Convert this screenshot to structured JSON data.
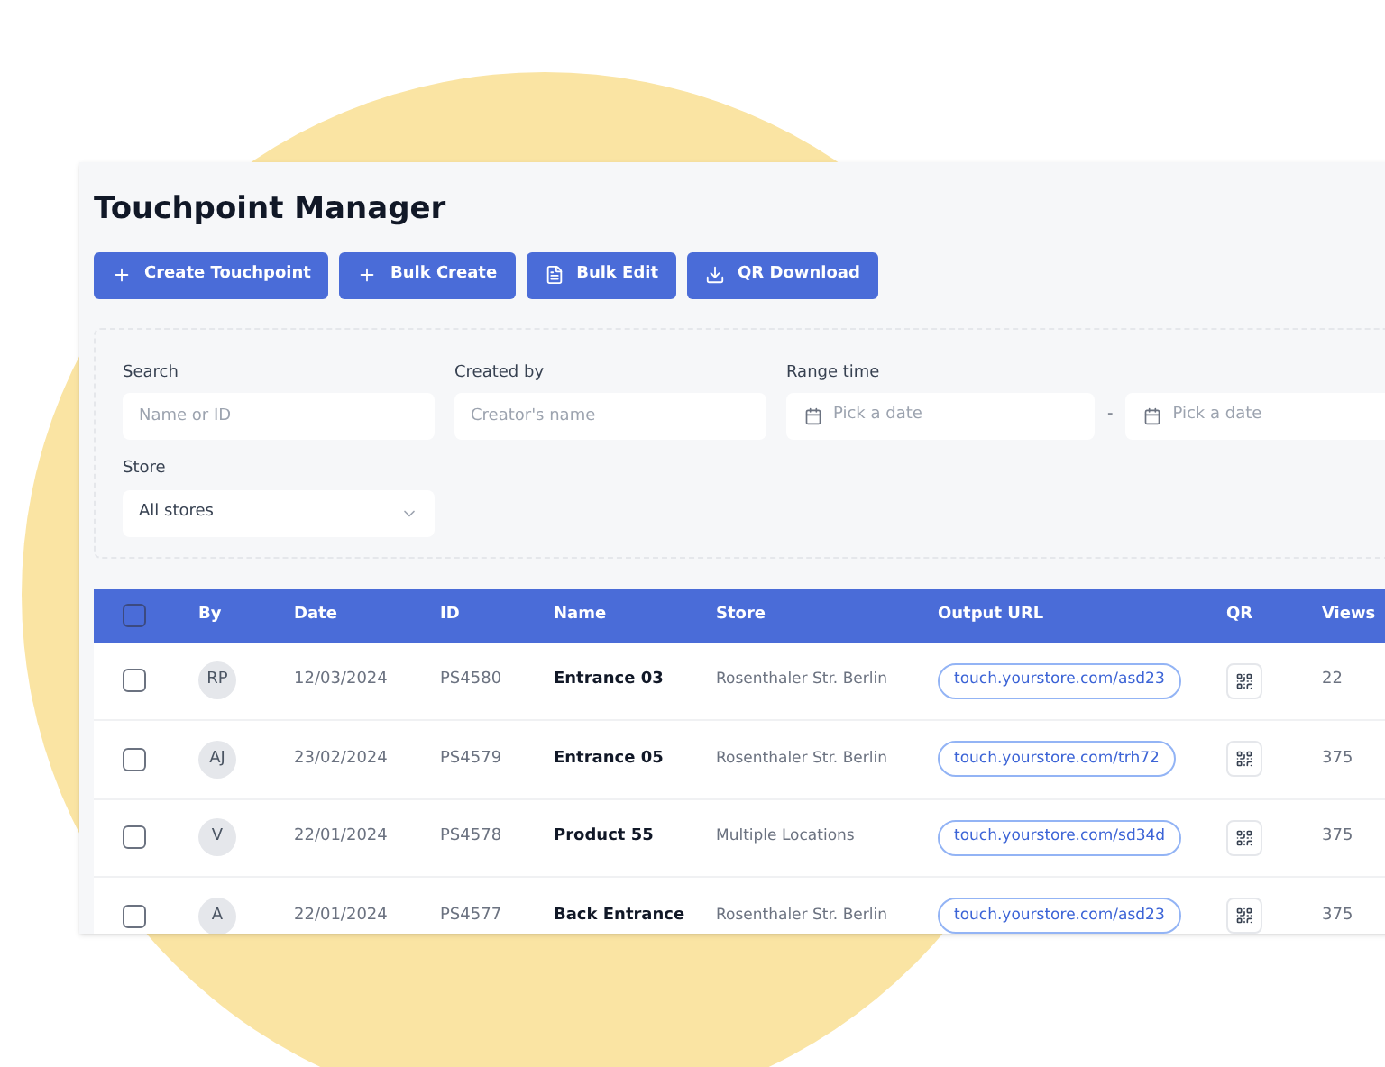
{
  "title": "Touchpoint Manager",
  "actions": [
    {
      "label": "Create Touchpoint",
      "kind": "plus"
    },
    {
      "label": "Bulk Create",
      "kind": "plus"
    },
    {
      "label": "Bulk Edit",
      "kind": "file"
    },
    {
      "label": "QR Download",
      "kind": "download"
    }
  ],
  "filters": {
    "search": {
      "label": "Search",
      "placeholder": "Name or ID"
    },
    "created_by": {
      "label": "Created by",
      "placeholder": "Creator's name"
    },
    "range_time": {
      "label": "Range time",
      "from_placeholder": "Pick a date",
      "separator": "-",
      "to_placeholder": "Pick a date"
    },
    "store": {
      "label": "Store",
      "value": "All stores"
    }
  },
  "table": {
    "select_all_checked": false,
    "columns": [
      "By",
      "Date",
      "ID",
      "Name",
      "Store",
      "Output URL",
      "QR",
      "Views"
    ],
    "rows": [
      {
        "checked": false,
        "by": "RP",
        "date": "12/03/2024",
        "id": "PS4580",
        "name": "Entrance 03",
        "store": "Rosenthaler Str. Berlin",
        "url": "touch.yourstore.com/asd23",
        "views": "22"
      },
      {
        "checked": false,
        "by": "AJ",
        "date": "23/02/2024",
        "id": "PS4579",
        "name": "Entrance 05",
        "store": "Rosenthaler Str. Berlin",
        "url": "touch.yourstore.com/trh72",
        "views": "375"
      },
      {
        "checked": false,
        "by": "V",
        "date": "22/01/2024",
        "id": "PS4578",
        "name": "Product 55",
        "store": "Multiple Locations",
        "url": "touch.yourstore.com/sd34d",
        "views": "375"
      },
      {
        "checked": false,
        "by": "A",
        "date": "22/01/2024",
        "id": "PS4577",
        "name": "Back Entrance",
        "store": "Rosenthaler Str. Berlin",
        "url": "touch.yourstore.com/asd23",
        "views": "375"
      }
    ]
  }
}
